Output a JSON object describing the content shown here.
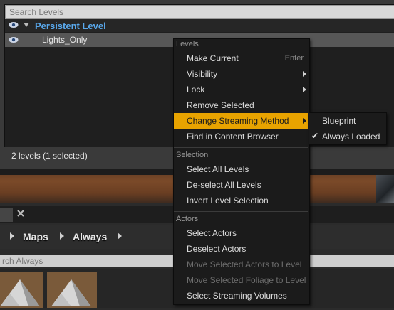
{
  "levels": {
    "search_placeholder": "Search Levels",
    "rows": [
      {
        "label": "Persistent Level",
        "visible_icon": "eye-icon",
        "expand_icon": "triangle-down-icon"
      },
      {
        "label": "Lights_Only",
        "visible_icon": "eye-icon"
      }
    ],
    "status": "2 levels (1 selected)"
  },
  "context_menu": {
    "sections": [
      {
        "header": "Levels",
        "items": [
          {
            "label": "Make Current",
            "shortcut": "Enter"
          },
          {
            "label": "Visibility",
            "submenu": true
          },
          {
            "label": "Lock",
            "submenu": true
          },
          {
            "label": "Remove Selected"
          },
          {
            "label": "Change Streaming Method",
            "submenu": true,
            "highlighted": true
          },
          {
            "label": "Find in Content Browser"
          }
        ]
      },
      {
        "header": "Selection",
        "items": [
          {
            "label": "Select All Levels"
          },
          {
            "label": "De-select All Levels"
          },
          {
            "label": "Invert Level Selection"
          }
        ]
      },
      {
        "header": "Actors",
        "items": [
          {
            "label": "Select Actors"
          },
          {
            "label": "Deselect Actors"
          },
          {
            "label": "Move Selected Actors to Level",
            "disabled": true
          },
          {
            "label": "Move Selected Foliage to Level",
            "disabled": true
          },
          {
            "label": "Select Streaming Volumes"
          }
        ]
      }
    ]
  },
  "submenu": {
    "items": [
      {
        "label": "Blueprint",
        "checked": false
      },
      {
        "label": "Always Loaded",
        "checked": true,
        "check_icon": "checkmark-icon"
      }
    ]
  },
  "content_browser": {
    "breadcrumbs": [
      "Maps",
      "Always"
    ],
    "search_placeholder": "rch Always"
  },
  "colors": {
    "highlight": "#e8a300",
    "persistent_level": "#59a8ec",
    "menu_bg": "#1b1b1b"
  }
}
